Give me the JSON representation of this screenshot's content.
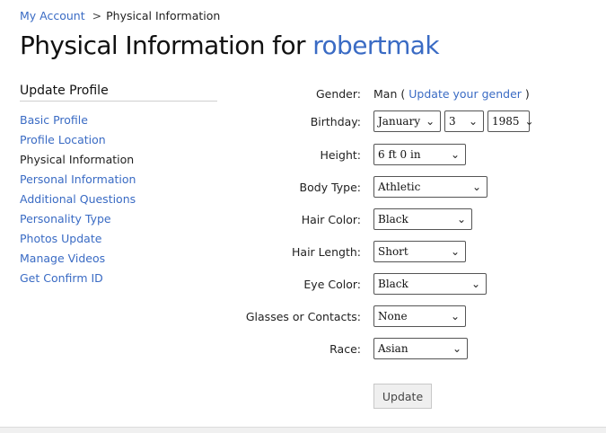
{
  "breadcrumb": {
    "parent": "My Account",
    "separator": ">",
    "current": "Physical Information"
  },
  "title": {
    "prefix": "Physical Information for",
    "username": "robertmak"
  },
  "sidebar": {
    "heading": "Update Profile",
    "items": [
      {
        "label": "Basic Profile",
        "active": false
      },
      {
        "label": "Profile Location",
        "active": false
      },
      {
        "label": "Physical Information",
        "active": true
      },
      {
        "label": "Personal Information",
        "active": false
      },
      {
        "label": "Additional Questions",
        "active": false
      },
      {
        "label": "Personality Type",
        "active": false
      },
      {
        "label": "Photos Update",
        "active": false
      },
      {
        "label": "Manage Videos",
        "active": false
      },
      {
        "label": "Get Confirm ID",
        "active": false
      }
    ]
  },
  "form": {
    "gender": {
      "label": "Gender:",
      "value": "Man",
      "open_paren": "(",
      "link": "Update your gender",
      "close_paren": ")"
    },
    "birthday": {
      "label": "Birthday:",
      "month": "January",
      "day": "3",
      "year": "1985"
    },
    "height": {
      "label": "Height:",
      "value": "6 ft 0 in"
    },
    "body_type": {
      "label": "Body Type:",
      "value": "Athletic"
    },
    "hair_color": {
      "label": "Hair Color:",
      "value": "Black"
    },
    "hair_length": {
      "label": "Hair Length:",
      "value": "Short"
    },
    "eye_color": {
      "label": "Eye Color:",
      "value": "Black"
    },
    "glasses": {
      "label": "Glasses or Contacts:",
      "value": "None"
    },
    "race": {
      "label": "Race:",
      "value": "Asian"
    },
    "submit_label": "Update"
  },
  "colors": {
    "link": "#3a6bc4",
    "text": "#222222"
  }
}
